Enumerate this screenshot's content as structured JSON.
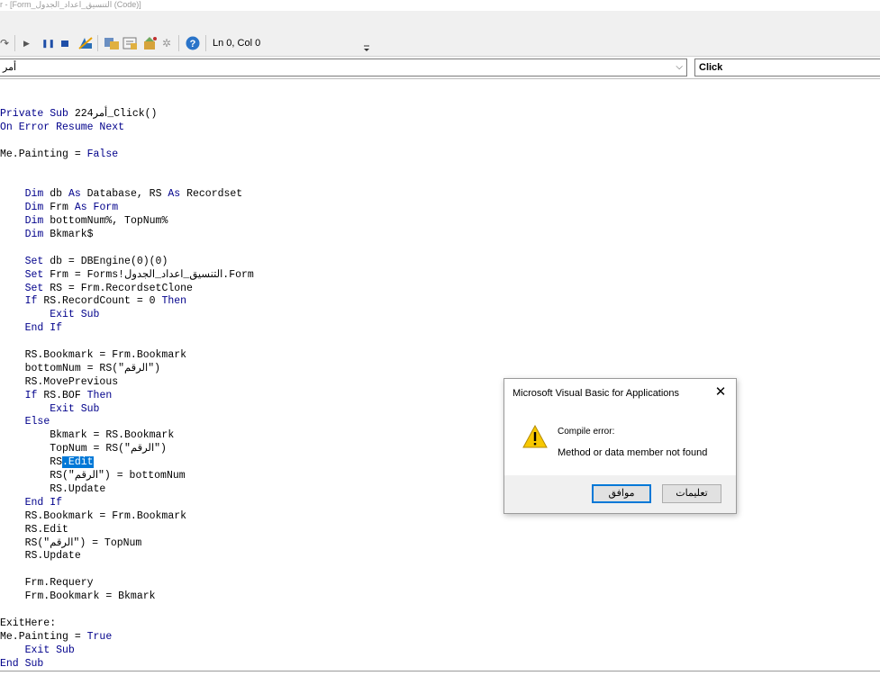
{
  "window": {
    "title": "r - [Form_التنسيق_اعداد_الجدول (Code)]"
  },
  "toolbar": {
    "position_label": "Ln 0, Col 0"
  },
  "combos": {
    "object_value": "أمر",
    "procedure_value": "Click"
  },
  "code": {
    "lines": [
      [
        {
          "t": "Private Sub ",
          "k": true
        },
        {
          "t": "أمر224_Click()"
        }
      ],
      [
        {
          "t": "On Error Resume Next",
          "k": true
        }
      ],
      [],
      [
        {
          "t": "Me.Painting = "
        },
        {
          "t": "False",
          "k": true
        }
      ],
      [],
      [],
      [
        {
          "t": "    "
        },
        {
          "t": "Dim",
          "k": true
        },
        {
          "t": " db "
        },
        {
          "t": "As",
          "k": true
        },
        {
          "t": " Database, RS "
        },
        {
          "t": "As",
          "k": true
        },
        {
          "t": " Recordset"
        }
      ],
      [
        {
          "t": "    "
        },
        {
          "t": "Dim",
          "k": true
        },
        {
          "t": " Frm "
        },
        {
          "t": "As Form",
          "k": true
        }
      ],
      [
        {
          "t": "    "
        },
        {
          "t": "Dim",
          "k": true
        },
        {
          "t": " bottomNum%, TopNum%"
        }
      ],
      [
        {
          "t": "    "
        },
        {
          "t": "Dim",
          "k": true
        },
        {
          "t": " Bkmark$"
        }
      ],
      [],
      [
        {
          "t": "    "
        },
        {
          "t": "Set",
          "k": true
        },
        {
          "t": " db = DBEngine(0)(0)"
        }
      ],
      [
        {
          "t": "    "
        },
        {
          "t": "Set",
          "k": true
        },
        {
          "t": " Frm = Forms!التنسيق_اعداد_الجدول.Form"
        }
      ],
      [
        {
          "t": "    "
        },
        {
          "t": "Set",
          "k": true
        },
        {
          "t": " RS = Frm.RecordsetClone"
        }
      ],
      [
        {
          "t": "    "
        },
        {
          "t": "If",
          "k": true
        },
        {
          "t": " RS.RecordCount = 0 "
        },
        {
          "t": "Then",
          "k": true
        }
      ],
      [
        {
          "t": "        "
        },
        {
          "t": "Exit Sub",
          "k": true
        }
      ],
      [
        {
          "t": "    "
        },
        {
          "t": "End If",
          "k": true
        }
      ],
      [],
      [
        {
          "t": "    RS.Bookmark = Frm.Bookmark"
        }
      ],
      [
        {
          "t": "    bottomNum = RS(\"الرقم\")"
        }
      ],
      [
        {
          "t": "    RS.MovePrevious"
        }
      ],
      [
        {
          "t": "    "
        },
        {
          "t": "If",
          "k": true
        },
        {
          "t": " RS.BOF "
        },
        {
          "t": "Then",
          "k": true
        }
      ],
      [
        {
          "t": "        "
        },
        {
          "t": "Exit Sub",
          "k": true
        }
      ],
      [
        {
          "t": "    "
        },
        {
          "t": "Else",
          "k": true
        }
      ],
      [
        {
          "t": "        Bkmark = RS.Bookmark"
        }
      ],
      [
        {
          "t": "        TopNum = RS(\"الرقم\")"
        }
      ],
      [
        {
          "t": "        RS"
        },
        {
          "t": ".Edit",
          "s": true
        }
      ],
      [
        {
          "t": "        RS(\"الرقم\") = bottomNum"
        }
      ],
      [
        {
          "t": "        RS.Update"
        }
      ],
      [
        {
          "t": "    "
        },
        {
          "t": "End If",
          "k": true
        }
      ],
      [
        {
          "t": "    RS.Bookmark = Frm.Bookmark"
        }
      ],
      [
        {
          "t": "    RS.Edit"
        }
      ],
      [
        {
          "t": "    RS(\"الرقم\") = TopNum"
        }
      ],
      [
        {
          "t": "    RS.Update"
        }
      ],
      [],
      [
        {
          "t": "    Frm.Requery"
        }
      ],
      [
        {
          "t": "    Frm.Bookmark = Bkmark"
        }
      ],
      [],
      [
        {
          "t": "ExitHere:"
        }
      ],
      [
        {
          "t": "Me.Painting = "
        },
        {
          "t": "True",
          "k": true
        }
      ],
      [
        {
          "t": "    "
        },
        {
          "t": "Exit Sub",
          "k": true
        }
      ],
      [
        {
          "t": "End Sub",
          "k": true
        }
      ]
    ]
  },
  "dialog": {
    "title": "Microsoft Visual Basic for Applications",
    "close_symbol": "✕",
    "line1": "Compile error:",
    "line2": "Method or data member not found",
    "ok_label": "موافق",
    "help_label": "تعليمات"
  },
  "colors": {
    "keyword": "#00008b",
    "selection": "#0078d7",
    "warning_fill": "#f7c800"
  },
  "icons": [
    "undo-icon",
    "run-icon",
    "pause-icon",
    "reset-icon",
    "design-mode-icon",
    "project-explorer-icon",
    "properties-icon",
    "object-browser-icon",
    "toolbox-icon",
    "help-icon",
    "warning-icon"
  ]
}
